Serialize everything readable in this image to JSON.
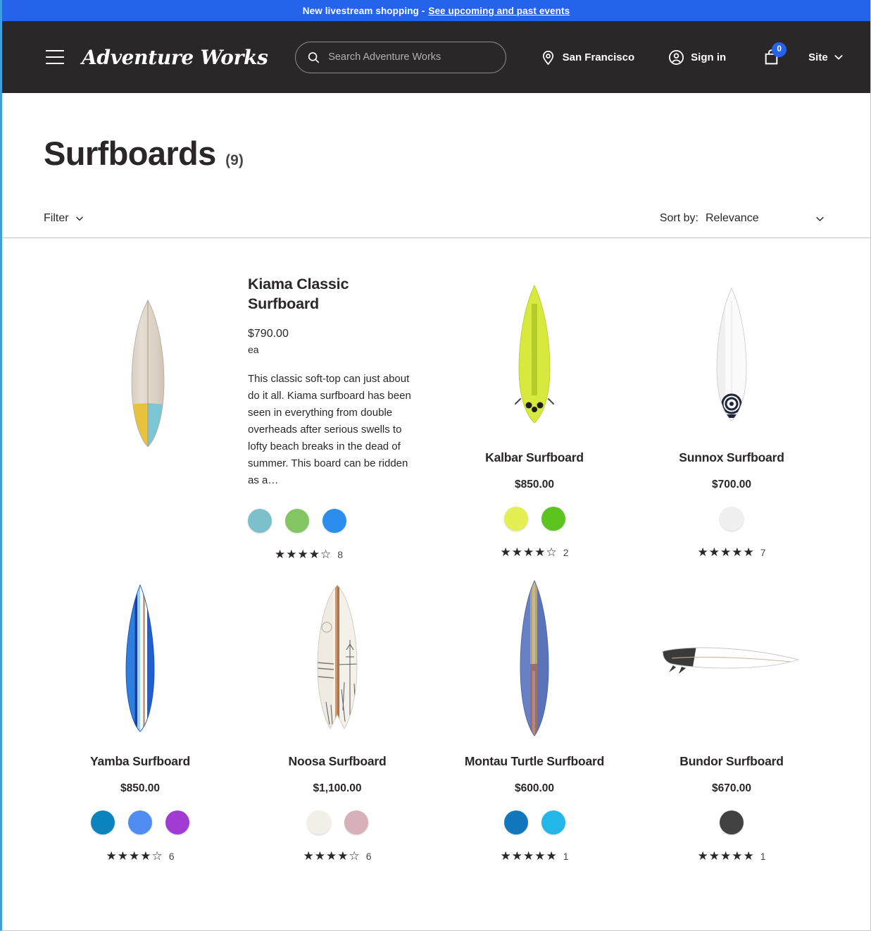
{
  "announcement": {
    "text": "New livestream shopping -",
    "link_label": "See upcoming and past events"
  },
  "header": {
    "menu_icon": "hamburger-menu-icon",
    "logo": "Adventure Works",
    "search": {
      "placeholder": "Search Adventure Works",
      "value": "",
      "icon": "search-icon"
    },
    "location": {
      "label": "San Francisco",
      "icon": "location-pin-icon"
    },
    "account": {
      "label": "Sign in",
      "icon": "user-circle-icon"
    },
    "cart": {
      "count": "0",
      "icon": "shopping-bag-icon",
      "badge_color": "#2563eb"
    },
    "site": {
      "label": "Site",
      "icon": "chevron-down-icon"
    }
  },
  "page": {
    "title": "Surfboards",
    "count": "(9)"
  },
  "toolbar": {
    "filter_label": "Filter",
    "filter_icon": "chevron-down-icon",
    "sort_label": "Sort by:",
    "sort_value": "Relevance",
    "sort_icon": "chevron-down-icon"
  },
  "products": [
    {
      "name": "Kiama Classic Surfboard",
      "price": "$790.00",
      "unit": "ea",
      "description": "This classic soft-top can just about do it all. Kiama surfboard has been seen in everything from double overheads after serious swells to lofty beach breaks in the dead of summer. This board can be ridden as a…",
      "featured": true,
      "swatches": [
        "#7cc0cc",
        "#84c563",
        "#2b8ded"
      ],
      "rating": 4.5,
      "rating_count": "8",
      "image": "kiama-longboard"
    },
    {
      "name": "Kalbar Surfboard",
      "price": "$850.00",
      "featured": false,
      "swatches": [
        "#e3ef53",
        "#5cc41f",
        null
      ],
      "rating": 4.5,
      "rating_count": "2",
      "image": "kalbar-shortboard"
    },
    {
      "name": "Sunnox Surfboard",
      "price": "$700.00",
      "featured": false,
      "swatches": [
        "#f0f0f0",
        null,
        null
      ],
      "rating": 5,
      "rating_count": "7",
      "image": "sunnox-shortboard"
    },
    {
      "name": "Yamba Surfboard",
      "price": "$850.00",
      "featured": false,
      "swatches": [
        "#0b83bd",
        "#4f8ef0",
        "#a03cd4"
      ],
      "rating": 4.5,
      "rating_count": "6",
      "image": "yamba-board"
    },
    {
      "name": "Noosa Surfboard",
      "price": "$1,100.00",
      "featured": false,
      "swatches": [
        "#f2efe9",
        "#d7b0ba",
        null
      ],
      "rating": 4.5,
      "rating_count": "6",
      "image": "noosa-fish"
    },
    {
      "name": "Montau Turtle Surfboard",
      "price": "$600.00",
      "featured": false,
      "swatches": [
        "#1277bc",
        "#22b7e8",
        null
      ],
      "rating": 5,
      "rating_count": "1",
      "image": "montau-longboard"
    },
    {
      "name": "Bundor Surfboard",
      "price": "$670.00",
      "featured": false,
      "swatches": [
        "#424242",
        null,
        null
      ],
      "rating": 5,
      "rating_count": "1",
      "image": "bundor-profile"
    }
  ]
}
